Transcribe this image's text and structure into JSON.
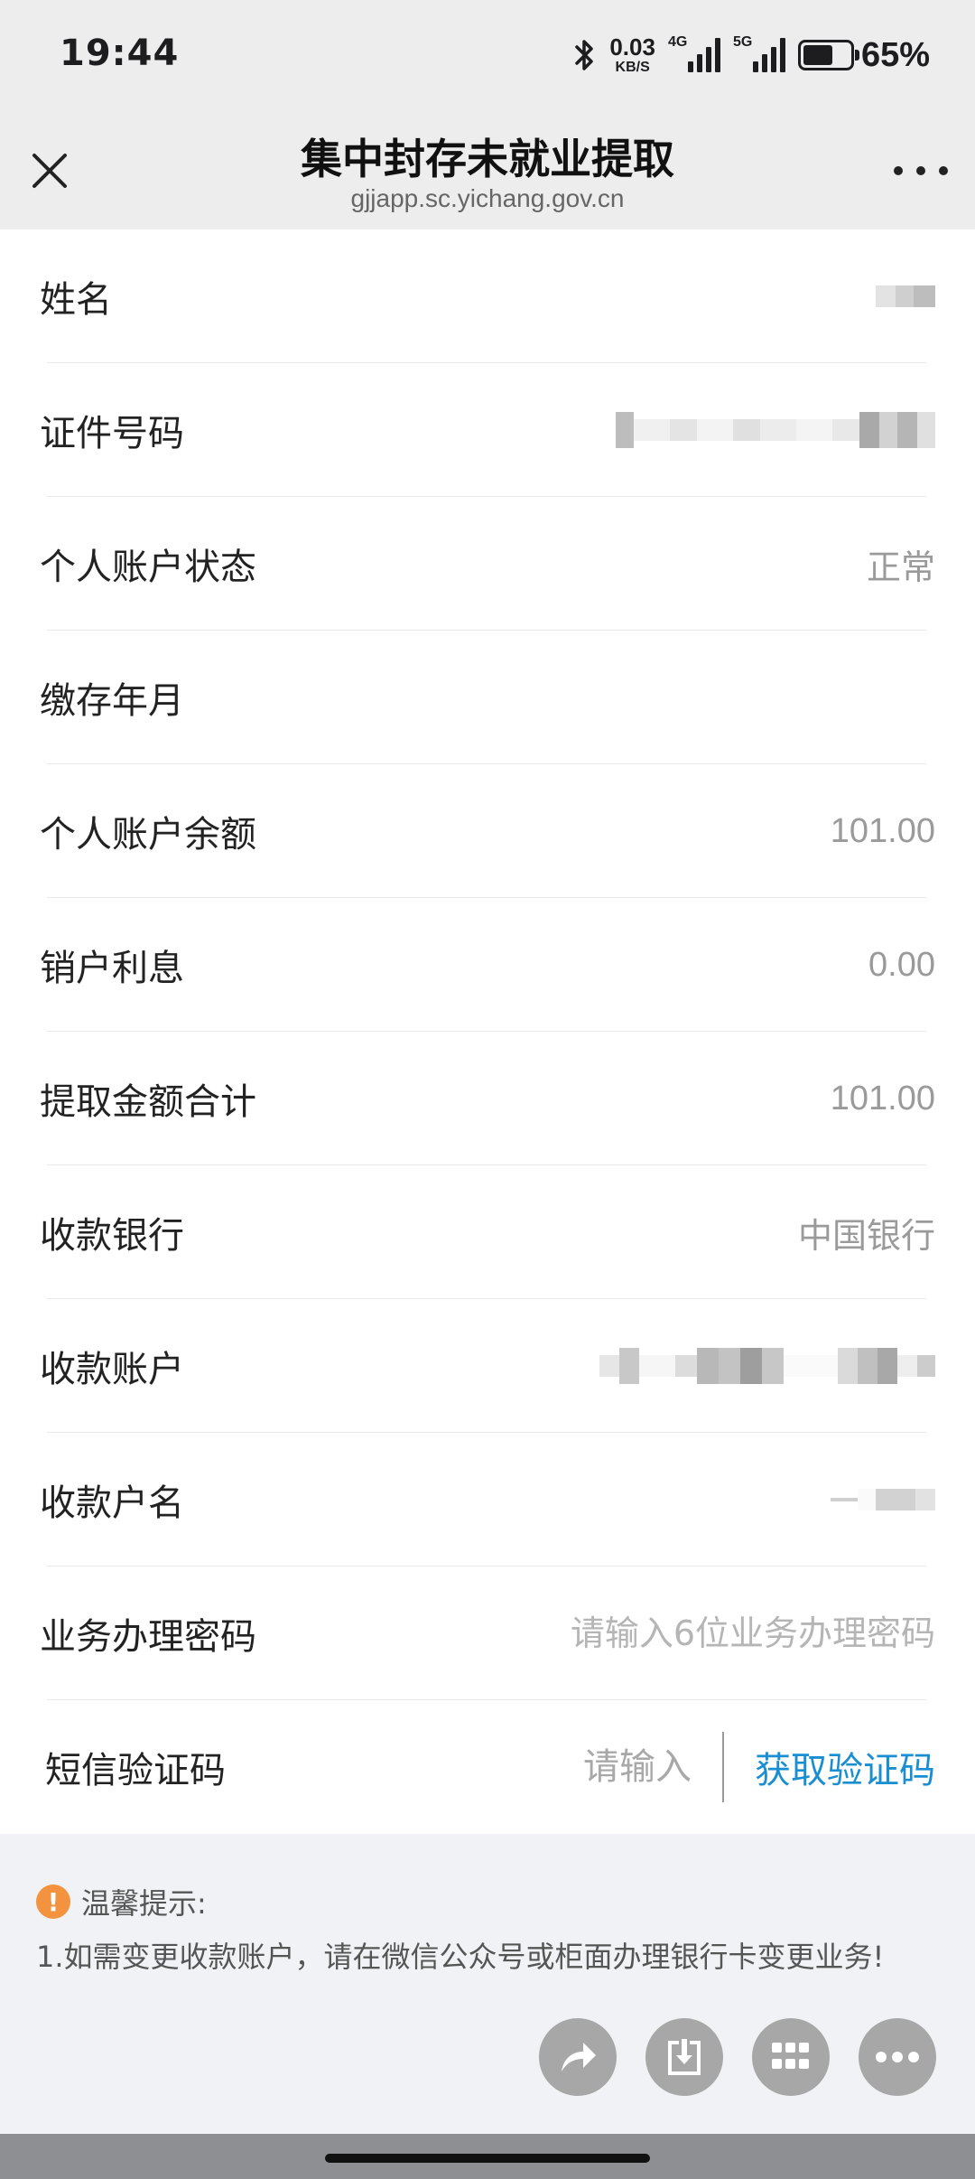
{
  "status_bar": {
    "time": "19:44",
    "net_speed_value": "0.03",
    "net_speed_unit": "KB/S",
    "signal_1_tag": "4G",
    "signal_2_tag": "5G",
    "battery_percent": "65%",
    "battery_level": 0.65
  },
  "header": {
    "title": "集中封存未就业提取",
    "domain": "gjjapp.sc.yichang.gov.cn"
  },
  "form": {
    "name_label": "姓名",
    "id_label": "证件号码",
    "status_label": "个人账户状态",
    "status_value": "正常",
    "period_label": "缴存年月",
    "balance_label": "个人账户余额",
    "balance_value": "101.00",
    "interest_label": "销户利息",
    "interest_value": "0.00",
    "total_label": "提取金额合计",
    "total_value": "101.00",
    "bank_label": "收款银行",
    "bank_value": "中国银行",
    "account_label": "收款账户",
    "account_name_label": "收款户名",
    "password_label": "业务办理密码",
    "password_placeholder": "请输入6位业务办理密码",
    "sms_label": "短信验证码",
    "sms_placeholder": "请输入",
    "sms_button": "获取验证码"
  },
  "tips": {
    "icon": "!",
    "title": "温馨提示:",
    "line1": "1.如需变更收款账户，请在微信公众号或柜面办理银行卡变更业务!"
  },
  "colors": {
    "accent": "#1a8ed1",
    "warning": "#f3923f"
  },
  "icons": {
    "close": "close-icon",
    "more": "more-icon",
    "share": "share-icon",
    "save": "save-icon",
    "apps": "apps-icon",
    "menu": "more-dots-icon"
  }
}
